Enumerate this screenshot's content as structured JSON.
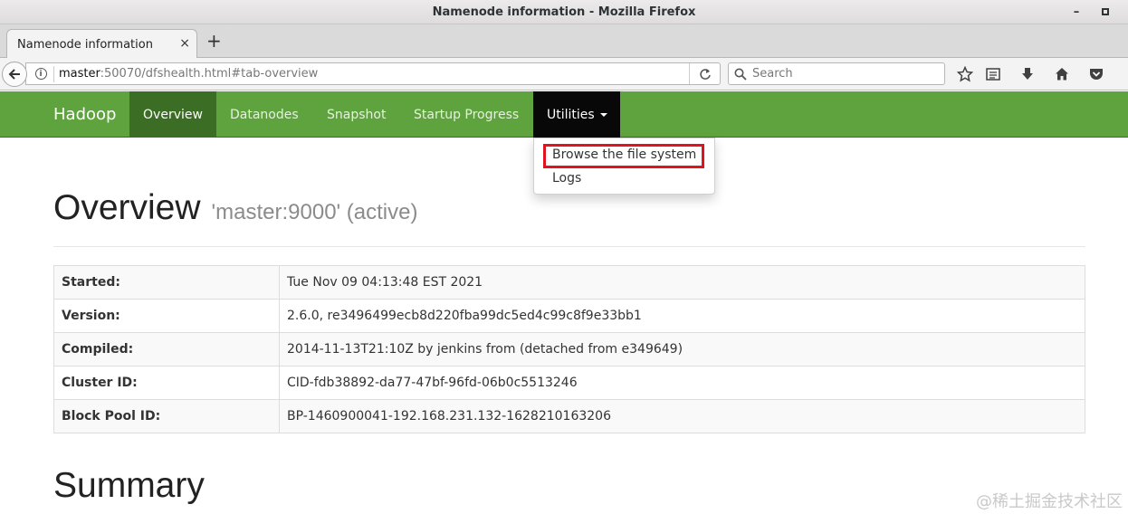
{
  "window": {
    "title": "Namenode information - Mozilla Firefox",
    "minimize_glyph": "–"
  },
  "tabs": [
    {
      "label": "Namenode information",
      "close_glyph": "×"
    }
  ],
  "newtab_glyph": "+",
  "toolbar": {
    "url_host": "master",
    "url_rest": ":50070/dfshealth.html#tab-overview",
    "search_placeholder": "Search",
    "icons": [
      "back-arrow-icon",
      "info-icon",
      "reload-icon",
      "search-icon",
      "bookmark-star-icon",
      "reader-list-icon",
      "download-icon",
      "home-icon",
      "pocket-icon"
    ]
  },
  "hadoop_nav": {
    "brand": "Hadoop",
    "items": [
      "Overview",
      "Datanodes",
      "Snapshot",
      "Startup Progress",
      "Utilities"
    ],
    "active": "Overview",
    "open_menu": "Utilities"
  },
  "utilities_menu": {
    "items": [
      "Browse the file system",
      "Logs"
    ],
    "highlighted": "Browse the file system"
  },
  "overview": {
    "title": "Overview",
    "subtitle": "'master:9000' (active)",
    "rows": [
      {
        "key": "Started:",
        "value": "Tue Nov 09 04:13:48 EST 2021"
      },
      {
        "key": "Version:",
        "value": "2.6.0, re3496499ecb8d220fba99dc5ed4c99c8f9e33bb1"
      },
      {
        "key": "Compiled:",
        "value": "2014-11-13T21:10Z by jenkins from (detached from e349649)"
      },
      {
        "key": "Cluster ID:",
        "value": "CID-fdb38892-da77-47bf-96fd-06b0c5513246"
      },
      {
        "key": "Block Pool ID:",
        "value": "BP-1460900041-192.168.231.132-1628210163206"
      }
    ]
  },
  "summary": {
    "title": "Summary"
  },
  "watermark": "@稀土掘金技术社区",
  "colors": {
    "navbar_green": "#5fa33e",
    "active_tab": "#3c6d25",
    "utilities_bg": "#080808",
    "highlight_red": "#e0141e"
  }
}
